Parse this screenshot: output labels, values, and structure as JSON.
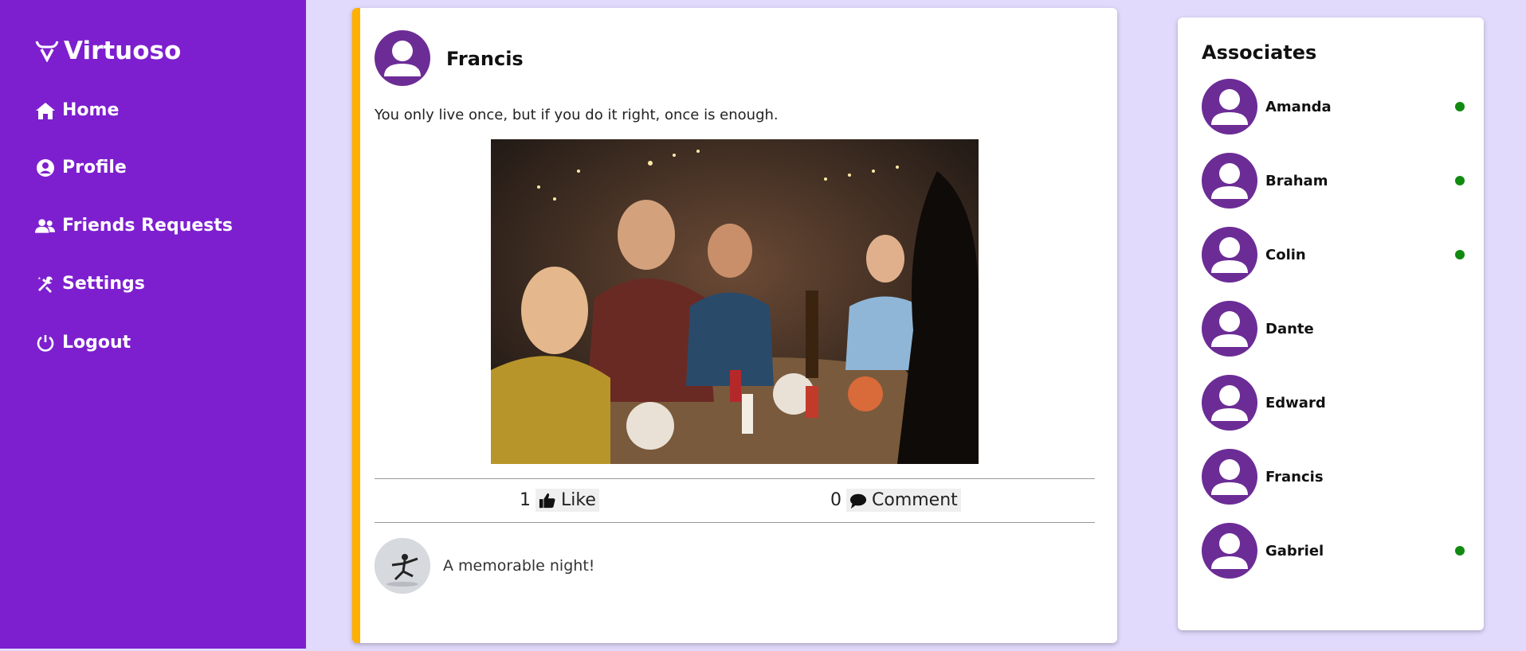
{
  "brand": {
    "name": "Virtuoso"
  },
  "nav": [
    {
      "label": "Home",
      "icon": "home-icon"
    },
    {
      "label": "Profile",
      "icon": "user-circle-icon"
    },
    {
      "label": "Friends Requests",
      "icon": "users-icon"
    },
    {
      "label": "Settings",
      "icon": "tools-icon"
    },
    {
      "label": "Logout",
      "icon": "power-icon"
    }
  ],
  "post": {
    "author": "Francis",
    "text": "You only live once, but if you do it right, once is enough.",
    "likes": "1",
    "like_label": "Like",
    "comments": "0",
    "comment_label": "Comment",
    "comment_input_value": "A memorable night!"
  },
  "associates": {
    "title": "Associates",
    "friends": [
      {
        "name": "Amanda",
        "online": true
      },
      {
        "name": "Braham",
        "online": true
      },
      {
        "name": "Colin",
        "online": true
      },
      {
        "name": "Dante",
        "online": false
      },
      {
        "name": "Edward",
        "online": false
      },
      {
        "name": "Francis",
        "online": false
      },
      {
        "name": "Gabriel",
        "online": true
      }
    ]
  },
  "colors": {
    "sidebar": "#7d1fcf",
    "accent": "#ffb000",
    "background": "#e2dafc",
    "online": "#118a11",
    "avatar": "#6c2c96"
  }
}
